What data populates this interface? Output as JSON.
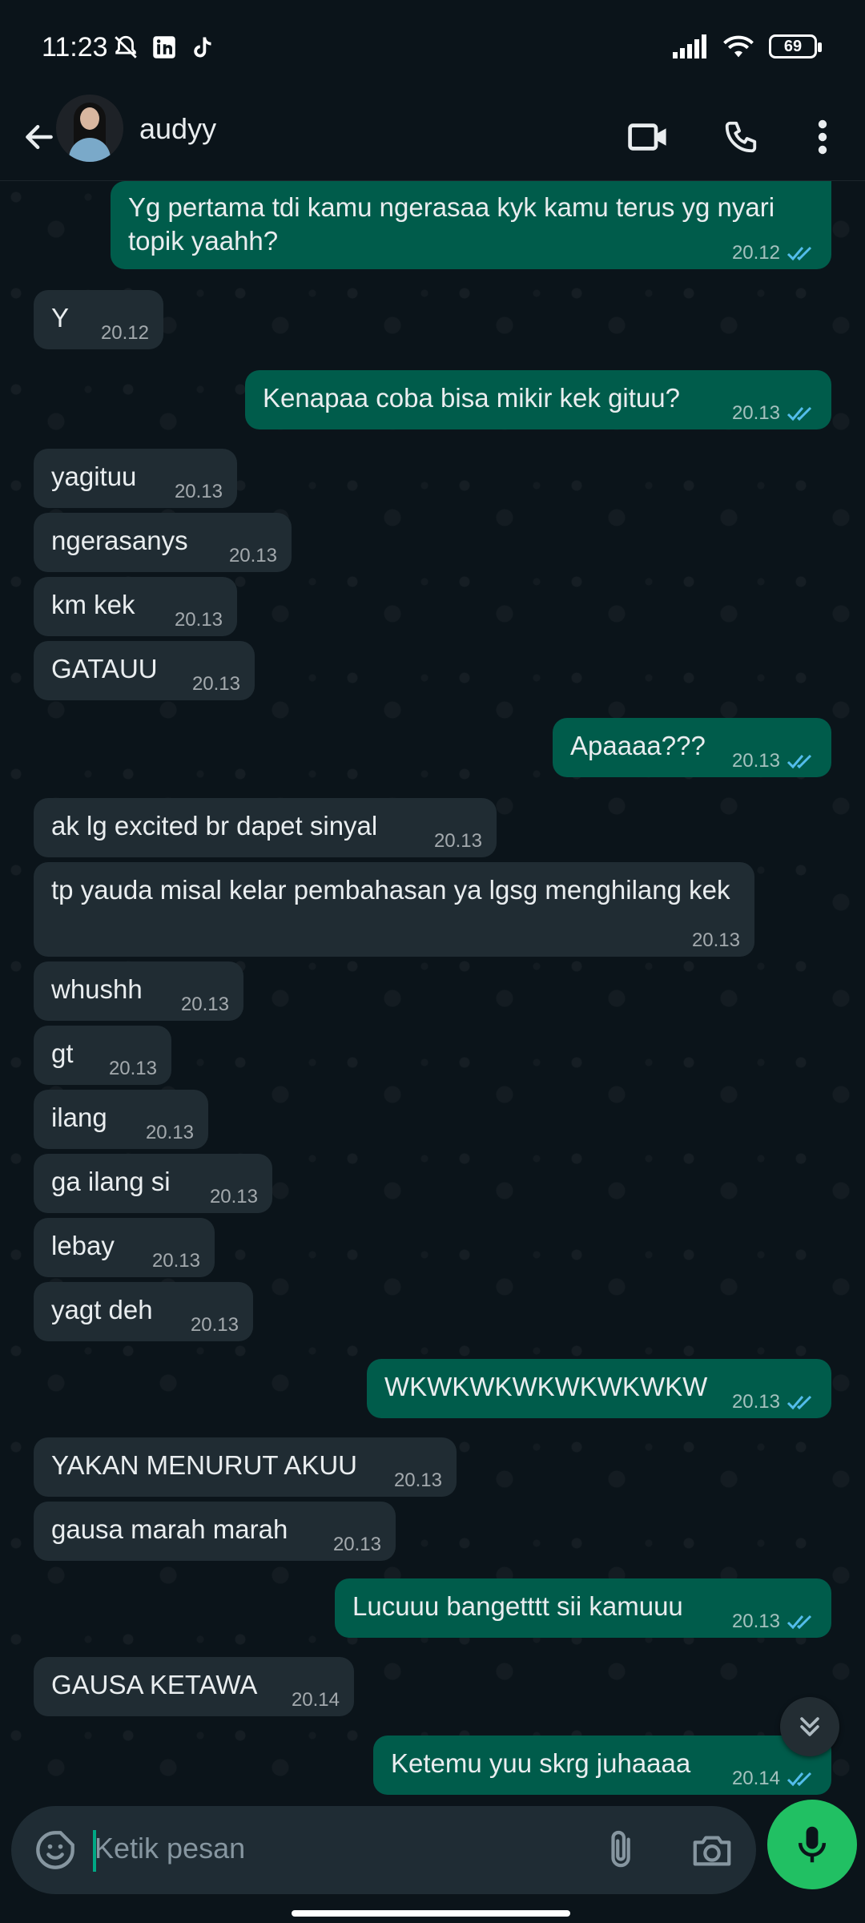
{
  "status_bar": {
    "time": "11:23",
    "battery": "69"
  },
  "header": {
    "contact_name": "audyy"
  },
  "messages": [
    {
      "dir": "out",
      "text": "Yg pertama tdi kamu ngerasaa kyk kamu terus yg nyari topik yaahh?",
      "time": "20.12"
    },
    {
      "dir": "in",
      "text": "Y",
      "time": "20.12"
    },
    {
      "dir": "out",
      "text": "Kenapaa coba bisa mikir kek gituu?",
      "time": "20.13"
    },
    {
      "dir": "in",
      "text": "yagituu",
      "time": "20.13"
    },
    {
      "dir": "in",
      "text": "ngerasanys",
      "time": "20.13"
    },
    {
      "dir": "in",
      "text": "km kek",
      "time": "20.13"
    },
    {
      "dir": "in",
      "text": "GATAUU",
      "time": "20.13"
    },
    {
      "dir": "out",
      "text": "Apaaaa???",
      "time": "20.13"
    },
    {
      "dir": "in",
      "text": "ak lg excited br dapet sinyal",
      "time": "20.13"
    },
    {
      "dir": "in",
      "text": "tp yauda misal kelar pembahasan ya lgsg menghilang kek",
      "time": "20.13"
    },
    {
      "dir": "in",
      "text": "whushh",
      "time": "20.13"
    },
    {
      "dir": "in",
      "text": "gt",
      "time": "20.13"
    },
    {
      "dir": "in",
      "text": "ilang",
      "time": "20.13"
    },
    {
      "dir": "in",
      "text": "ga ilang si",
      "time": "20.13"
    },
    {
      "dir": "in",
      "text": "lebay",
      "time": "20.13"
    },
    {
      "dir": "in",
      "text": "yagt deh",
      "time": "20.13"
    },
    {
      "dir": "out",
      "text": "WKWKWKWKWKWKWKW",
      "time": "20.13"
    },
    {
      "dir": "in",
      "text": "YAKAN MENURUT AKUU",
      "time": "20.13"
    },
    {
      "dir": "in",
      "text": "gausa marah marah",
      "time": "20.13"
    },
    {
      "dir": "out",
      "text": "Lucuuu bangetttt sii kamuuu",
      "time": "20.13"
    },
    {
      "dir": "in",
      "text": "GAUSA KETAWA",
      "time": "20.14"
    },
    {
      "dir": "out",
      "text": "Ketemu yuu skrg juhaaaa",
      "time": "20.14"
    }
  ],
  "composer": {
    "placeholder": "Ketik pesan"
  },
  "colors": {
    "incoming": "#202c33",
    "outgoing": "#005c4b",
    "read_tick": "#53bdeb",
    "mic": "#21c063"
  },
  "icons": [
    "back-arrow-icon",
    "video-call-icon",
    "phone-icon",
    "more-vert-icon",
    "chevron-double-down-icon",
    "sticker-icon",
    "attach-icon",
    "camera-icon",
    "mic-icon"
  ]
}
